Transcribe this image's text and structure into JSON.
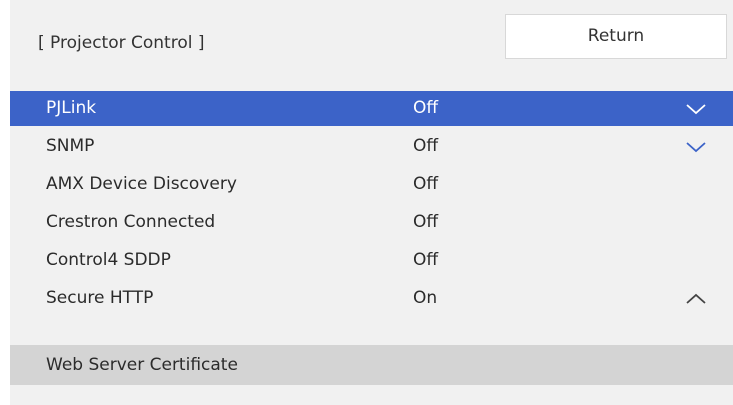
{
  "header": {
    "title": "[ Projector Control ]",
    "return_label": "Return"
  },
  "rows": [
    {
      "label": "PJLink",
      "value": "Off",
      "icon": "chevron-down",
      "selected": true
    },
    {
      "label": "SNMP",
      "value": "Off",
      "icon": "chevron-down",
      "selected": false
    },
    {
      "label": "AMX Device Discovery",
      "value": "Off",
      "icon": "",
      "selected": false
    },
    {
      "label": "Crestron Connected",
      "value": "Off",
      "icon": "",
      "selected": false
    },
    {
      "label": "Control4 SDDP",
      "value": "Off",
      "icon": "",
      "selected": false
    },
    {
      "label": "Secure HTTP",
      "value": "On",
      "icon": "chevron-up",
      "selected": false
    }
  ],
  "subitem": {
    "label": "Web Server Certificate"
  },
  "colors": {
    "selected_bg": "#3c63c8",
    "panel_bg": "#f1f1f1",
    "subitem_bg": "#d4d4d4"
  }
}
